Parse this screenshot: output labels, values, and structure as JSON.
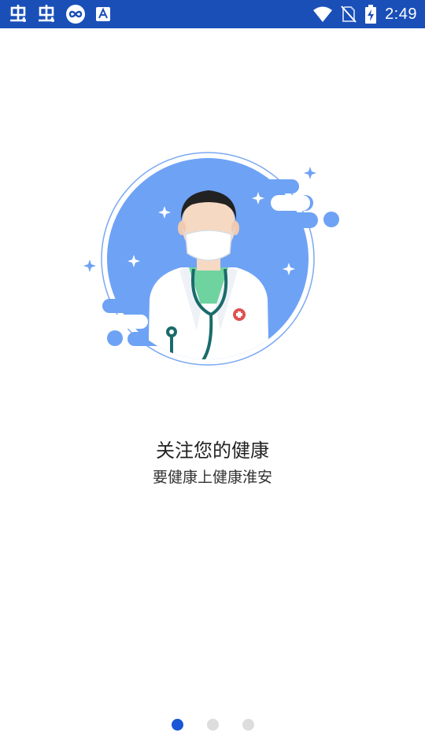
{
  "status_bar": {
    "time": "2:49",
    "left_icons": [
      "chinese-char-app-icon",
      "chinese-char-app-icon",
      "infinity-app-icon",
      "text-a-app-icon"
    ],
    "right_icons": [
      "wifi-icon",
      "no-sim-icon",
      "battery-charging-icon"
    ],
    "background": "#1a4fb8"
  },
  "onboarding": {
    "title": "关注您的健康",
    "subtitle": "要健康上健康淮安",
    "illustration": "doctor-with-mask-illustration",
    "accent_color": "#6ea2f5"
  },
  "pager": {
    "pages": 3,
    "current": 1,
    "active_color": "#1a56d6",
    "inactive_color": "#dddddd"
  }
}
